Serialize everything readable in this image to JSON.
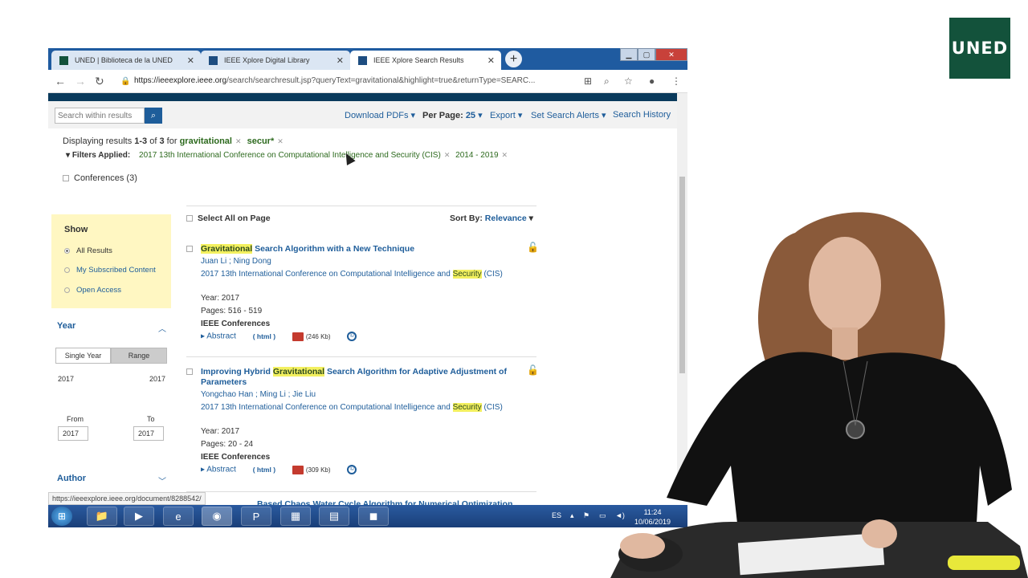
{
  "logo": {
    "text": "UNED"
  },
  "browser": {
    "tabs": [
      {
        "label": "UNED | Biblioteca de la UNED"
      },
      {
        "label": "IEEE Xplore Digital Library"
      },
      {
        "label": "IEEE Xplore Search Results"
      }
    ],
    "url_host": "https://ieeexplore.ieee.org",
    "url_path": "/search/searchresult.jsp?queryText=gravitational&highlight=true&returnType=SEARC...",
    "status_url": "https://ieeexplore.ieee.org/document/8288542/"
  },
  "toolbar": {
    "search_placeholder": "Search within results",
    "download_pdfs": "Download PDFs",
    "per_page_label": "Per Page:",
    "per_page_value": "25",
    "export": "Export",
    "set_alerts": "Set Search Alerts",
    "search_history": "Search History"
  },
  "summary": {
    "displaying": "Displaying results",
    "range": "1-3",
    "of": "of",
    "total": "3",
    "for": "for",
    "term1": "gravitational",
    "term2": "secur*",
    "filters_label": "Filters Applied:",
    "filter1": "2017 13th International Conference on Computational Intelligence and Security (CIS)",
    "filter2": "2014 - 2019",
    "conferences": "Conferences (3)"
  },
  "show": {
    "heading": "Show",
    "options": [
      {
        "label": "All Results",
        "selected": true
      },
      {
        "label": "My Subscribed Content",
        "selected": false
      },
      {
        "label": "Open Access",
        "selected": false
      }
    ]
  },
  "year": {
    "heading": "Year",
    "single": "Single Year",
    "range": "Range",
    "min": "2017",
    "max": "2017",
    "from_label": "From",
    "to_label": "To",
    "from_value": "2017",
    "to_value": "2017"
  },
  "author": {
    "heading": "Author"
  },
  "results_header": {
    "select_all": "Select All on Page",
    "sort_label": "Sort By:",
    "sort_value": "Relevance"
  },
  "results": [
    {
      "title_hl": "Gravitational",
      "title_rest": " Search Algorithm with a New Technique",
      "authors": "Juan Li ; Ning Dong",
      "pub_pre": "2017 13th International Conference on Computational Intelligence and ",
      "pub_hl": "Security",
      "pub_post": " (CIS)",
      "year": "Year: 2017",
      "pages": "Pages: 516 - 519",
      "type": "IEEE Conferences",
      "abstract": "Abstract",
      "html": "( html )",
      "pdf": "(246 Kb)"
    },
    {
      "title_pre": "Improving Hybrid ",
      "title_hl": "Gravitational",
      "title_rest": " Search Algorithm for Adaptive Adjustment of Parameters",
      "authors": "Yongchao Han ; Ming Li ; Jie Liu",
      "pub_pre": "2017 13th International Conference on Computational Intelligence and ",
      "pub_hl": "Security",
      "pub_post": " (CIS)",
      "year": "Year: 2017",
      "pages": "Pages: 20 - 24",
      "type": "IEEE Conferences",
      "abstract": "Abstract",
      "html": "( html )",
      "pdf": "(309 Kb)"
    }
  ],
  "partial_result": "Based Chaos Water Cycle Algorithm for Numerical Optimization",
  "taskbar": {
    "lang": "ES",
    "time": "11:24",
    "date": "10/06/2019"
  }
}
